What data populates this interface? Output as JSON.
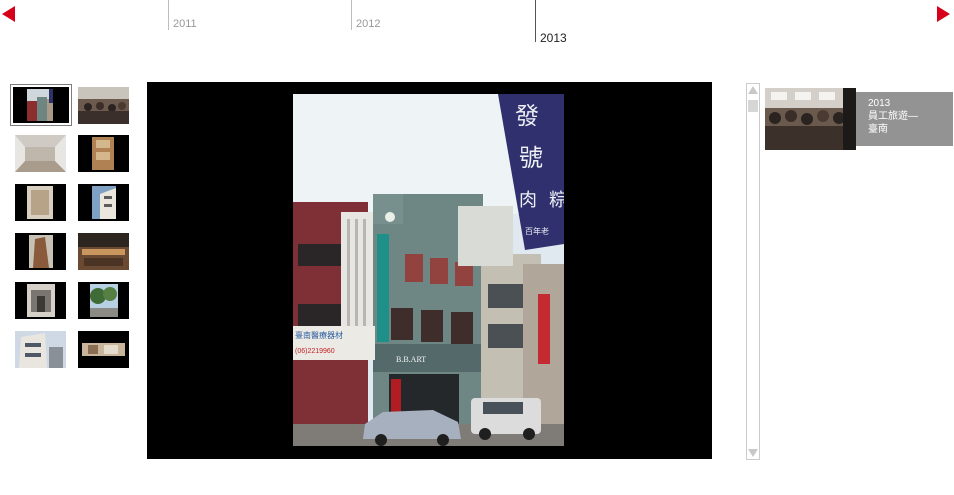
{
  "timeline": {
    "years": [
      {
        "label": "2011",
        "active": false
      },
      {
        "label": "2012",
        "active": false
      },
      {
        "label": "2013",
        "active": true
      }
    ]
  },
  "thumbnails": [
    {
      "name": "thumb-storefront",
      "selected": true
    },
    {
      "name": "thumb-crowd-hall"
    },
    {
      "name": "thumb-corridor"
    },
    {
      "name": "thumb-wood-panel"
    },
    {
      "name": "thumb-tall-panel"
    },
    {
      "name": "thumb-building-corner"
    },
    {
      "name": "thumb-tower"
    },
    {
      "name": "thumb-dining-room"
    },
    {
      "name": "thumb-street-arch"
    },
    {
      "name": "thumb-trees-road"
    },
    {
      "name": "thumb-building-angle"
    },
    {
      "name": "thumb-dark-interior"
    }
  ],
  "viewer": {
    "sign_left": "臺南醫療器材",
    "phone": "(06)2219960",
    "shop_name": "B.B.ART",
    "banner_chars": [
      "發",
      "號",
      "肉",
      "粽"
    ],
    "banner_sub": "百年老"
  },
  "album": {
    "year": "2013",
    "title_line1": "員工旅遊—",
    "title_line2": "臺南"
  },
  "colors": {
    "accent": "#d7001a",
    "card_bg": "#939393"
  }
}
